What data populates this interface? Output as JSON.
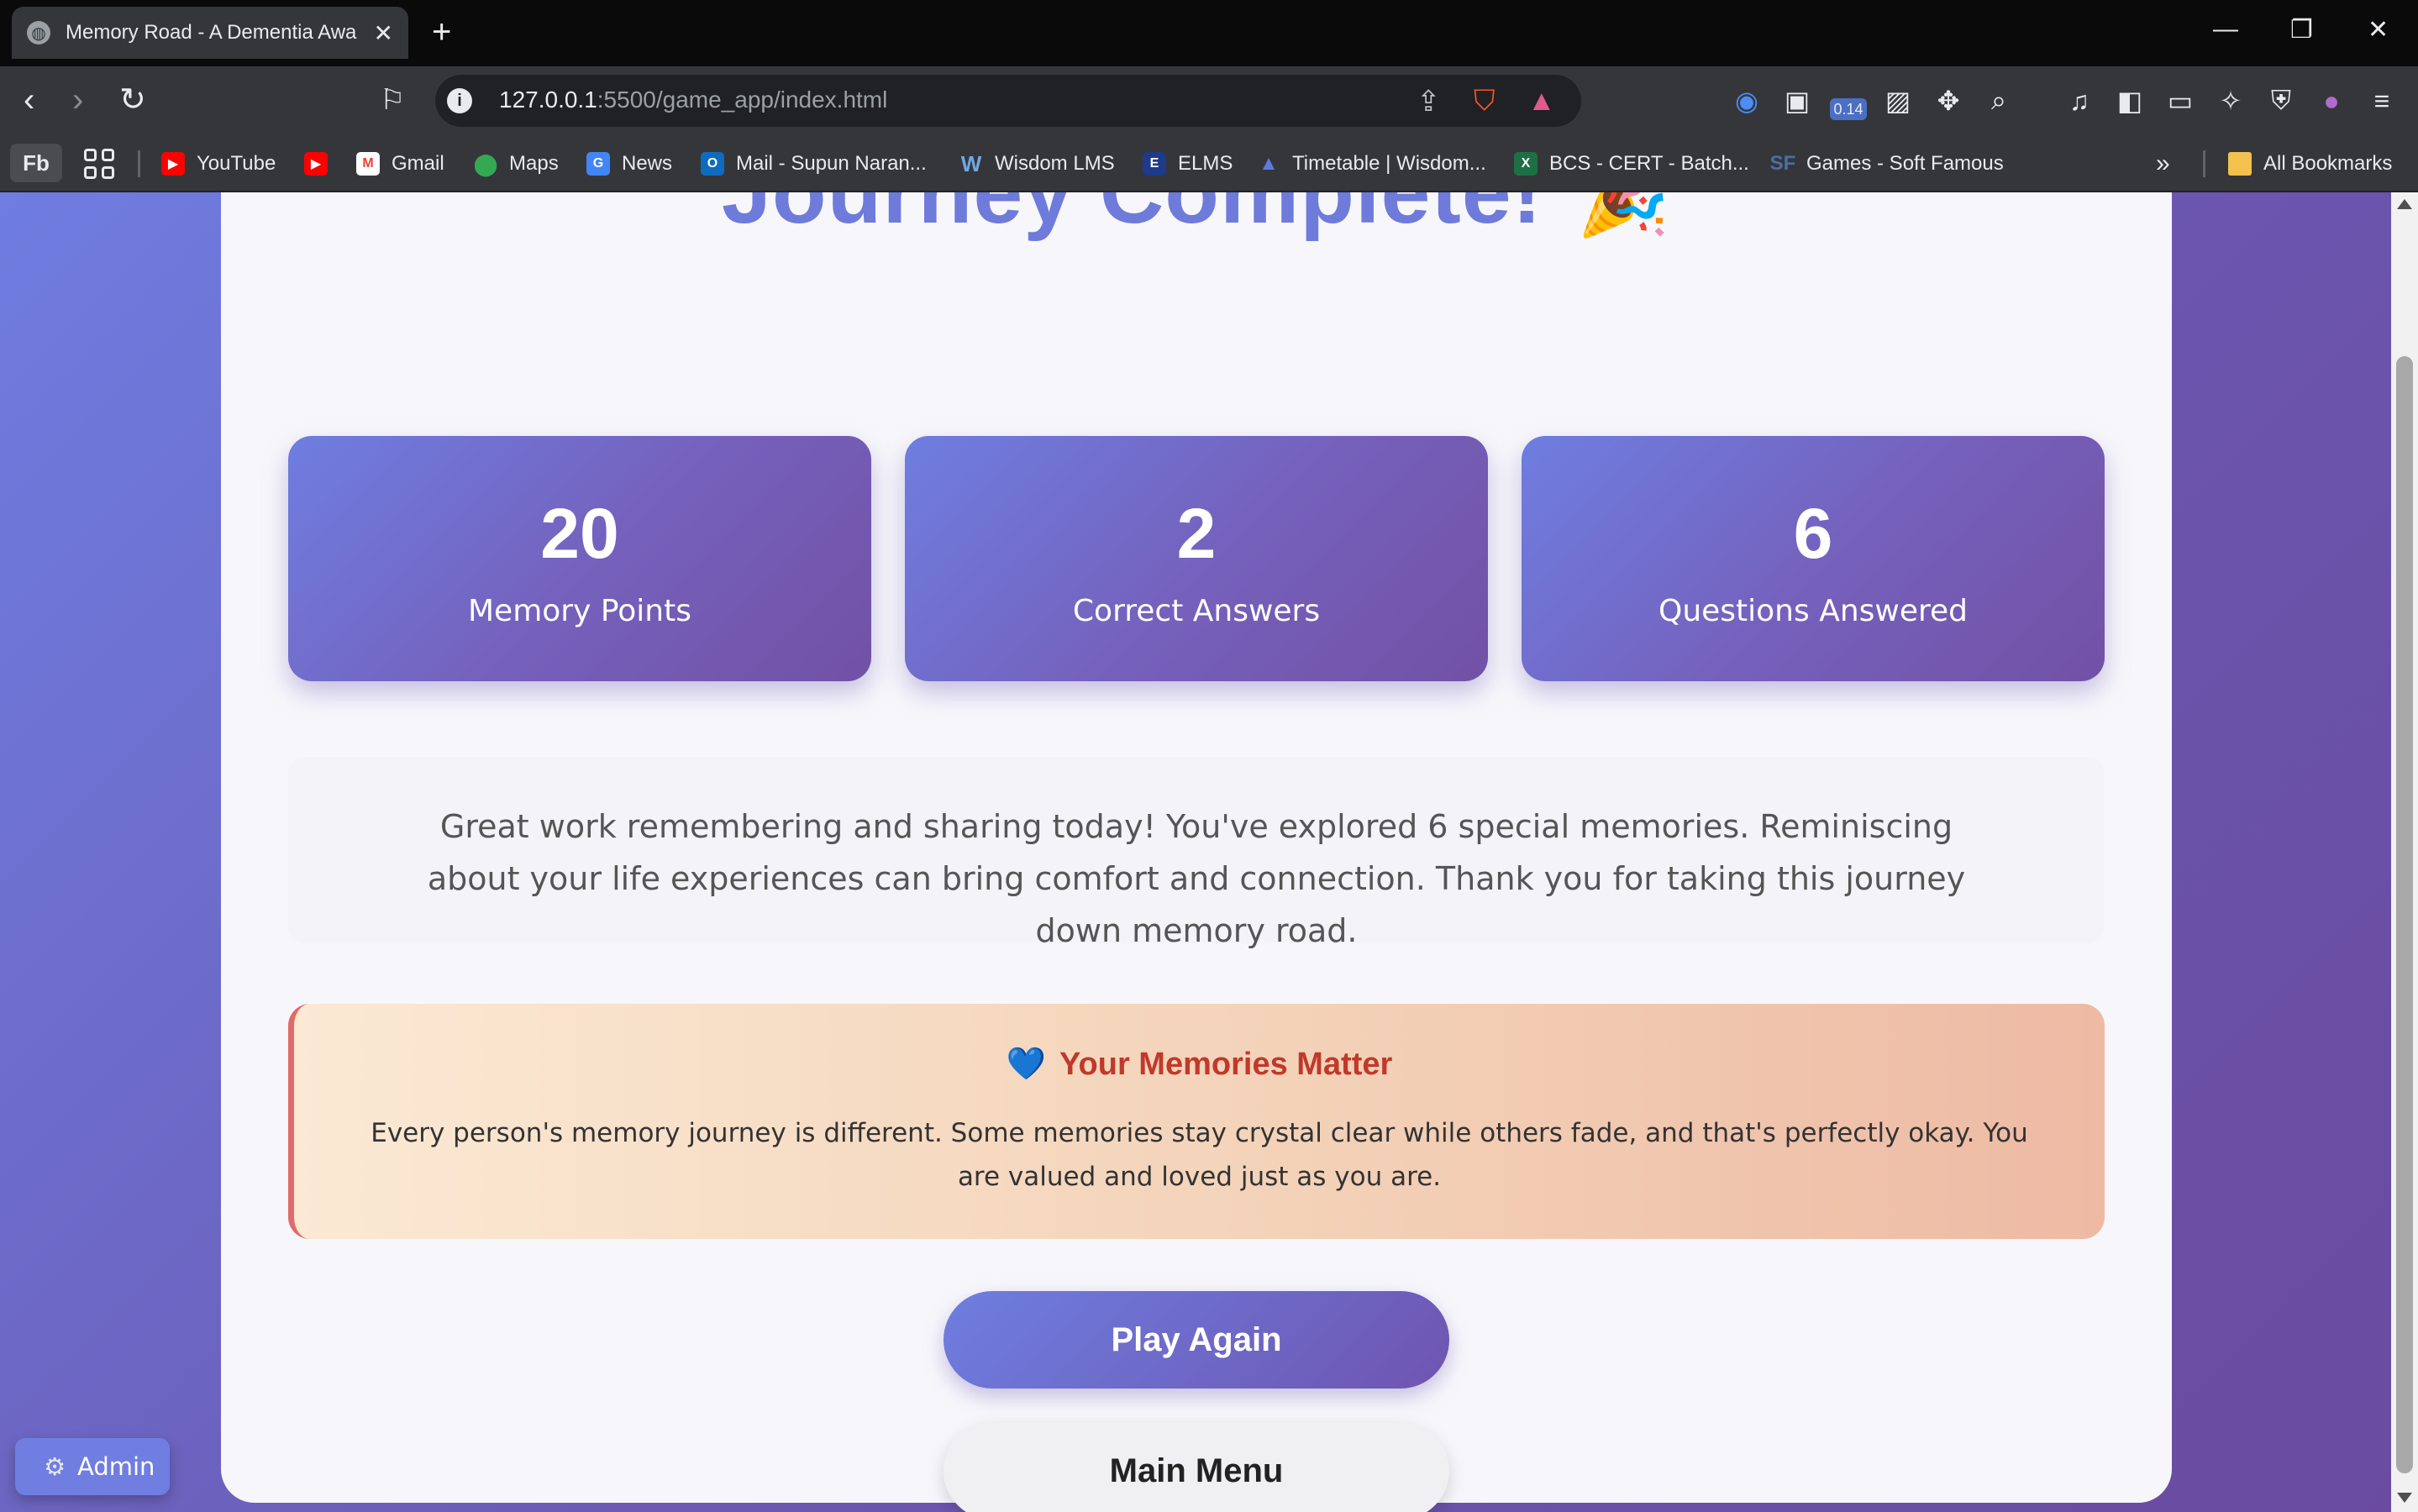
{
  "browser": {
    "tab_title": "Memory Road - A Dementia Awa",
    "url_host": "127.0.0.1",
    "url_rest": ":5500/game_app/index.html",
    "bookmarks": [
      {
        "label": "YouTube",
        "color": "#ff0000"
      },
      {
        "label": "",
        "color": "#ff0000"
      },
      {
        "label": "Gmail",
        "color": "#ea4335"
      },
      {
        "label": "Maps",
        "color": "#34a853"
      },
      {
        "label": "News",
        "color": "#4285f4"
      },
      {
        "label": "Mail - Supun Naran...",
        "color": "#0f6cbd"
      },
      {
        "label": "Wisdom LMS",
        "color": "#4a90d9"
      },
      {
        "label": "ELMS",
        "color": "#1e3a8a"
      },
      {
        "label": "Timetable | Wisdom...",
        "color": "#3b5bdb"
      },
      {
        "label": "BCS - CERT - Batch...",
        "color": "#1d7044"
      },
      {
        "label": "Games - Soft Famous",
        "color": "#4a6fa5"
      }
    ],
    "fb_label": "Fb",
    "all_bookmarks": "All Bookmarks",
    "ext_badge": "0.14"
  },
  "page": {
    "title": "Journey Complete!",
    "title_emoji": "🎉",
    "stats": [
      {
        "value": "20",
        "label": "Memory Points"
      },
      {
        "value": "2",
        "label": "Correct Answers"
      },
      {
        "value": "6",
        "label": "Questions Answered"
      }
    ],
    "message": "Great work remembering and sharing today! You've explored 6 special memories. Reminiscing about your life experiences can bring comfort and connection. Thank you for taking this journey down memory road.",
    "matter_title": "Your Memories Matter",
    "matter_icon": "💙",
    "matter_text": "Every person's memory journey is different. Some memories stay crystal clear while others fade, and that's perfectly okay. You are valued and loved just as you are.",
    "play_again": "Play Again",
    "main_menu": "Main Menu",
    "admin_label": "Admin",
    "admin_icon": "⚙"
  }
}
